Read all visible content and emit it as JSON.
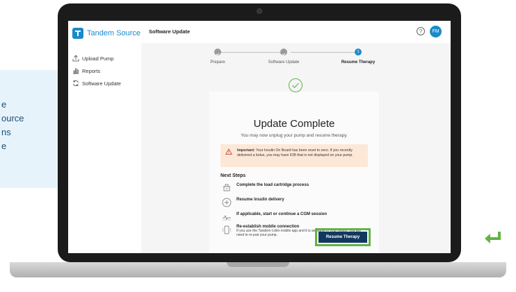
{
  "callout": {
    "lines": [
      "e",
      "ource",
      "ns",
      "e"
    ]
  },
  "app": {
    "brand": "Tandem Source",
    "brand_mark": "T"
  },
  "sidebar": {
    "items": [
      {
        "label": "Upload Pump",
        "icon": "upload-icon"
      },
      {
        "label": "Reports",
        "icon": "bar-chart-icon"
      },
      {
        "label": "Software Update",
        "icon": "refresh-icon"
      }
    ]
  },
  "header": {
    "title": "Software Update",
    "help_glyph": "?",
    "avatar_initials": "FM"
  },
  "stepper": {
    "steps": [
      {
        "label": "Prepare",
        "state": "complete"
      },
      {
        "label": "Software Update",
        "state": "complete"
      },
      {
        "label": "Resume Therapy",
        "state": "active",
        "number": "3"
      }
    ]
  },
  "main": {
    "title": "Update Complete",
    "subtitle": "You may now unplug your pump and resume therapy.",
    "alert": {
      "strong": "Important:",
      "text": " Your Insulin On Board has been reset to zero. If you recently delivered a bolus, you may have IOB that is not displayed on your pump."
    },
    "next_steps_title": "Next Steps",
    "next_steps": [
      {
        "label": "Complete the load cartridge process",
        "icon": "cartridge-icon"
      },
      {
        "label": "Resume insulin delivery",
        "icon": "insulin-drop-icon"
      },
      {
        "label": "If applicable, start or continue a CGM session",
        "icon": "cgm-sensor-icon"
      },
      {
        "label": "Re-establish mobile connection",
        "icon": "mobile-phone-icon",
        "description": "If you use the Tandem t:slim mobile app and it is available in your region, you will need to re-pair your pump."
      }
    ],
    "resume_button": "Resume Therapy"
  },
  "colors": {
    "brand": "#1b8ac9",
    "button": "#13385f",
    "highlight": "#5fb543",
    "alert_bg": "#fde8d8"
  }
}
